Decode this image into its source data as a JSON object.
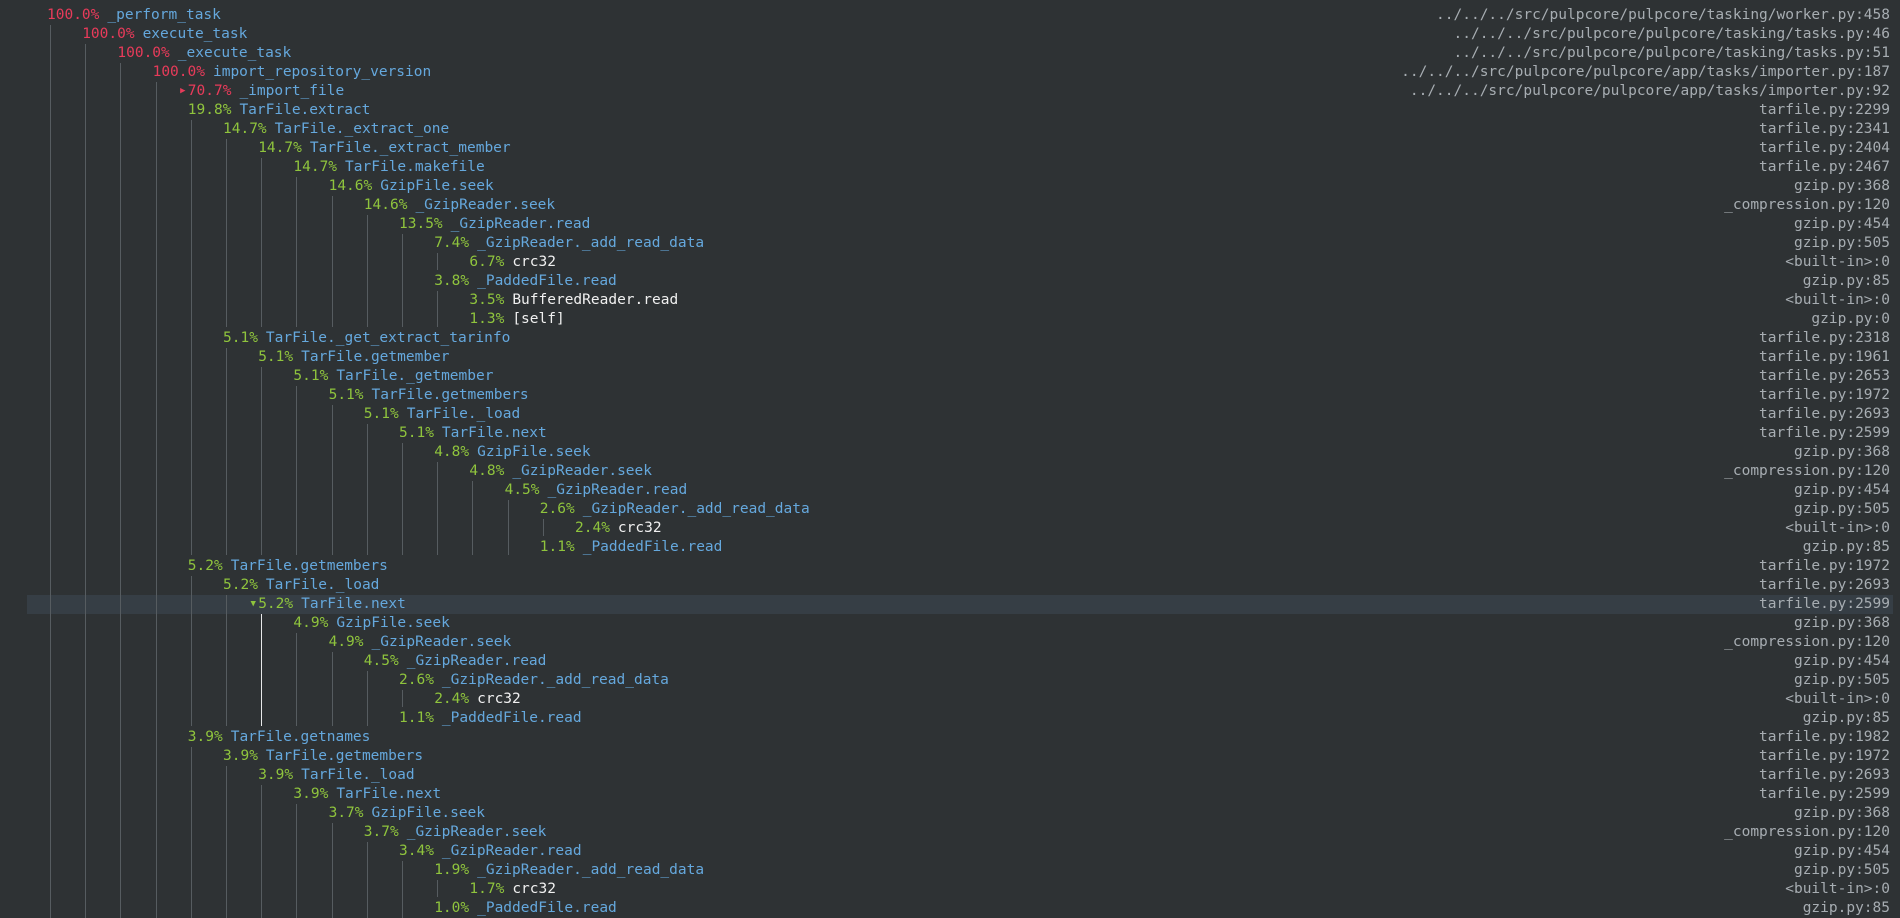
{
  "rows": [
    {
      "pct": "100.0%",
      "name": "_perform_task",
      "loc": "../../../src/pulpcore/pulpcore/tasking/worker.py:458",
      "depth": 0,
      "heat": "hot",
      "kind": "code"
    },
    {
      "pct": "100.0%",
      "name": "execute_task",
      "loc": "../../../src/pulpcore/pulpcore/tasking/tasks.py:46",
      "depth": 1,
      "heat": "hot",
      "kind": "code"
    },
    {
      "pct": "100.0%",
      "name": "_execute_task",
      "loc": "../../../src/pulpcore/pulpcore/tasking/tasks.py:51",
      "depth": 2,
      "heat": "hot",
      "kind": "code"
    },
    {
      "pct": "100.0%",
      "name": "import_repository_version",
      "loc": "../../../src/pulpcore/pulpcore/app/tasks/importer.py:187",
      "depth": 3,
      "heat": "hot",
      "kind": "code"
    },
    {
      "pct": "70.7%",
      "name": "_import_file",
      "loc": "../../../src/pulpcore/pulpcore/app/tasks/importer.py:92",
      "depth": 4,
      "heat": "hot",
      "kind": "code",
      "toggle": "collapsed"
    },
    {
      "pct": "19.8%",
      "name": "TarFile.extract",
      "loc": "tarfile.py:2299",
      "depth": 4,
      "heat": "warm",
      "kind": "code"
    },
    {
      "pct": "14.7%",
      "name": "TarFile._extract_one",
      "loc": "tarfile.py:2341",
      "depth": 5,
      "heat": "warm",
      "kind": "code"
    },
    {
      "pct": "14.7%",
      "name": "TarFile._extract_member",
      "loc": "tarfile.py:2404",
      "depth": 6,
      "heat": "warm",
      "kind": "code"
    },
    {
      "pct": "14.7%",
      "name": "TarFile.makefile",
      "loc": "tarfile.py:2467",
      "depth": 7,
      "heat": "warm",
      "kind": "code"
    },
    {
      "pct": "14.6%",
      "name": "GzipFile.seek",
      "loc": "gzip.py:368",
      "depth": 8,
      "heat": "warm",
      "kind": "code"
    },
    {
      "pct": "14.6%",
      "name": "_GzipReader.seek",
      "loc": "_compression.py:120",
      "depth": 9,
      "heat": "warm",
      "kind": "code"
    },
    {
      "pct": "13.5%",
      "name": "_GzipReader.read",
      "loc": "gzip.py:454",
      "depth": 10,
      "heat": "warm",
      "kind": "code"
    },
    {
      "pct": "7.4%",
      "name": "_GzipReader._add_read_data",
      "loc": "gzip.py:505",
      "depth": 11,
      "heat": "warm",
      "kind": "code"
    },
    {
      "pct": "6.7%",
      "name": "crc32",
      "loc": "<built-in>:0",
      "depth": 12,
      "heat": "warm",
      "kind": "builtin"
    },
    {
      "pct": "3.8%",
      "name": "_PaddedFile.read",
      "loc": "gzip.py:85",
      "depth": 11,
      "heat": "warm",
      "kind": "code"
    },
    {
      "pct": "3.5%",
      "name": "BufferedReader.read",
      "loc": "<built-in>:0",
      "depth": 12,
      "heat": "warm",
      "kind": "builtin"
    },
    {
      "pct": "1.3%",
      "name": "[self]",
      "loc": "gzip.py:0",
      "depth": 12,
      "heat": "warm",
      "kind": "builtin"
    },
    {
      "pct": "5.1%",
      "name": "TarFile._get_extract_tarinfo",
      "loc": "tarfile.py:2318",
      "depth": 5,
      "heat": "warm",
      "kind": "code"
    },
    {
      "pct": "5.1%",
      "name": "TarFile.getmember",
      "loc": "tarfile.py:1961",
      "depth": 6,
      "heat": "warm",
      "kind": "code"
    },
    {
      "pct": "5.1%",
      "name": "TarFile._getmember",
      "loc": "tarfile.py:2653",
      "depth": 7,
      "heat": "warm",
      "kind": "code"
    },
    {
      "pct": "5.1%",
      "name": "TarFile.getmembers",
      "loc": "tarfile.py:1972",
      "depth": 8,
      "heat": "warm",
      "kind": "code"
    },
    {
      "pct": "5.1%",
      "name": "TarFile._load",
      "loc": "tarfile.py:2693",
      "depth": 9,
      "heat": "warm",
      "kind": "code"
    },
    {
      "pct": "5.1%",
      "name": "TarFile.next",
      "loc": "tarfile.py:2599",
      "depth": 10,
      "heat": "warm",
      "kind": "code"
    },
    {
      "pct": "4.8%",
      "name": "GzipFile.seek",
      "loc": "gzip.py:368",
      "depth": 11,
      "heat": "warm",
      "kind": "code"
    },
    {
      "pct": "4.8%",
      "name": "_GzipReader.seek",
      "loc": "_compression.py:120",
      "depth": 12,
      "heat": "warm",
      "kind": "code"
    },
    {
      "pct": "4.5%",
      "name": "_GzipReader.read",
      "loc": "gzip.py:454",
      "depth": 13,
      "heat": "warm",
      "kind": "code"
    },
    {
      "pct": "2.6%",
      "name": "_GzipReader._add_read_data",
      "loc": "gzip.py:505",
      "depth": 14,
      "heat": "warm",
      "kind": "code"
    },
    {
      "pct": "2.4%",
      "name": "crc32",
      "loc": "<built-in>:0",
      "depth": 15,
      "heat": "warm",
      "kind": "builtin"
    },
    {
      "pct": "1.1%",
      "name": "_PaddedFile.read",
      "loc": "gzip.py:85",
      "depth": 14,
      "heat": "warm",
      "kind": "code"
    },
    {
      "pct": "5.2%",
      "name": "TarFile.getmembers",
      "loc": "tarfile.py:1972",
      "depth": 4,
      "heat": "warm",
      "kind": "code"
    },
    {
      "pct": "5.2%",
      "name": "TarFile._load",
      "loc": "tarfile.py:2693",
      "depth": 5,
      "heat": "warm",
      "kind": "code"
    },
    {
      "pct": "5.2%",
      "name": "TarFile.next",
      "loc": "tarfile.py:2599",
      "depth": 6,
      "heat": "warm",
      "kind": "code",
      "toggle": "expanded",
      "selected": true
    },
    {
      "pct": "4.9%",
      "name": "GzipFile.seek",
      "loc": "gzip.py:368",
      "depth": 7,
      "heat": "warm",
      "kind": "code"
    },
    {
      "pct": "4.9%",
      "name": "_GzipReader.seek",
      "loc": "_compression.py:120",
      "depth": 8,
      "heat": "warm",
      "kind": "code"
    },
    {
      "pct": "4.5%",
      "name": "_GzipReader.read",
      "loc": "gzip.py:454",
      "depth": 9,
      "heat": "warm",
      "kind": "code"
    },
    {
      "pct": "2.6%",
      "name": "_GzipReader._add_read_data",
      "loc": "gzip.py:505",
      "depth": 10,
      "heat": "warm",
      "kind": "code"
    },
    {
      "pct": "2.4%",
      "name": "crc32",
      "loc": "<built-in>:0",
      "depth": 11,
      "heat": "warm",
      "kind": "builtin"
    },
    {
      "pct": "1.1%",
      "name": "_PaddedFile.read",
      "loc": "gzip.py:85",
      "depth": 10,
      "heat": "warm",
      "kind": "code"
    },
    {
      "pct": "3.9%",
      "name": "TarFile.getnames",
      "loc": "tarfile.py:1982",
      "depth": 4,
      "heat": "warm",
      "kind": "code"
    },
    {
      "pct": "3.9%",
      "name": "TarFile.getmembers",
      "loc": "tarfile.py:1972",
      "depth": 5,
      "heat": "warm",
      "kind": "code"
    },
    {
      "pct": "3.9%",
      "name": "TarFile._load",
      "loc": "tarfile.py:2693",
      "depth": 6,
      "heat": "warm",
      "kind": "code"
    },
    {
      "pct": "3.9%",
      "name": "TarFile.next",
      "loc": "tarfile.py:2599",
      "depth": 7,
      "heat": "warm",
      "kind": "code"
    },
    {
      "pct": "3.7%",
      "name": "GzipFile.seek",
      "loc": "gzip.py:368",
      "depth": 8,
      "heat": "warm",
      "kind": "code"
    },
    {
      "pct": "3.7%",
      "name": "_GzipReader.seek",
      "loc": "_compression.py:120",
      "depth": 9,
      "heat": "warm",
      "kind": "code"
    },
    {
      "pct": "3.4%",
      "name": "_GzipReader.read",
      "loc": "gzip.py:454",
      "depth": 10,
      "heat": "warm",
      "kind": "code"
    },
    {
      "pct": "1.9%",
      "name": "_GzipReader._add_read_data",
      "loc": "gzip.py:505",
      "depth": 11,
      "heat": "warm",
      "kind": "code"
    },
    {
      "pct": "1.7%",
      "name": "crc32",
      "loc": "<built-in>:0",
      "depth": 12,
      "heat": "warm",
      "kind": "builtin"
    },
    {
      "pct": "1.0%",
      "name": "_PaddedFile.read",
      "loc": "gzip.py:85",
      "depth": 11,
      "heat": "warm",
      "kind": "code"
    }
  ],
  "colors": {
    "background": "#2e3234",
    "hot": "#e83b5a",
    "warm": "#8fc43d",
    "function": "#65a8dd",
    "builtin": "#f0f0f0",
    "location": "#a7adb2",
    "selected_row": "#363e45"
  },
  "icons": {
    "collapsed": "triangle-right-icon",
    "expanded": "triangle-down-icon"
  }
}
